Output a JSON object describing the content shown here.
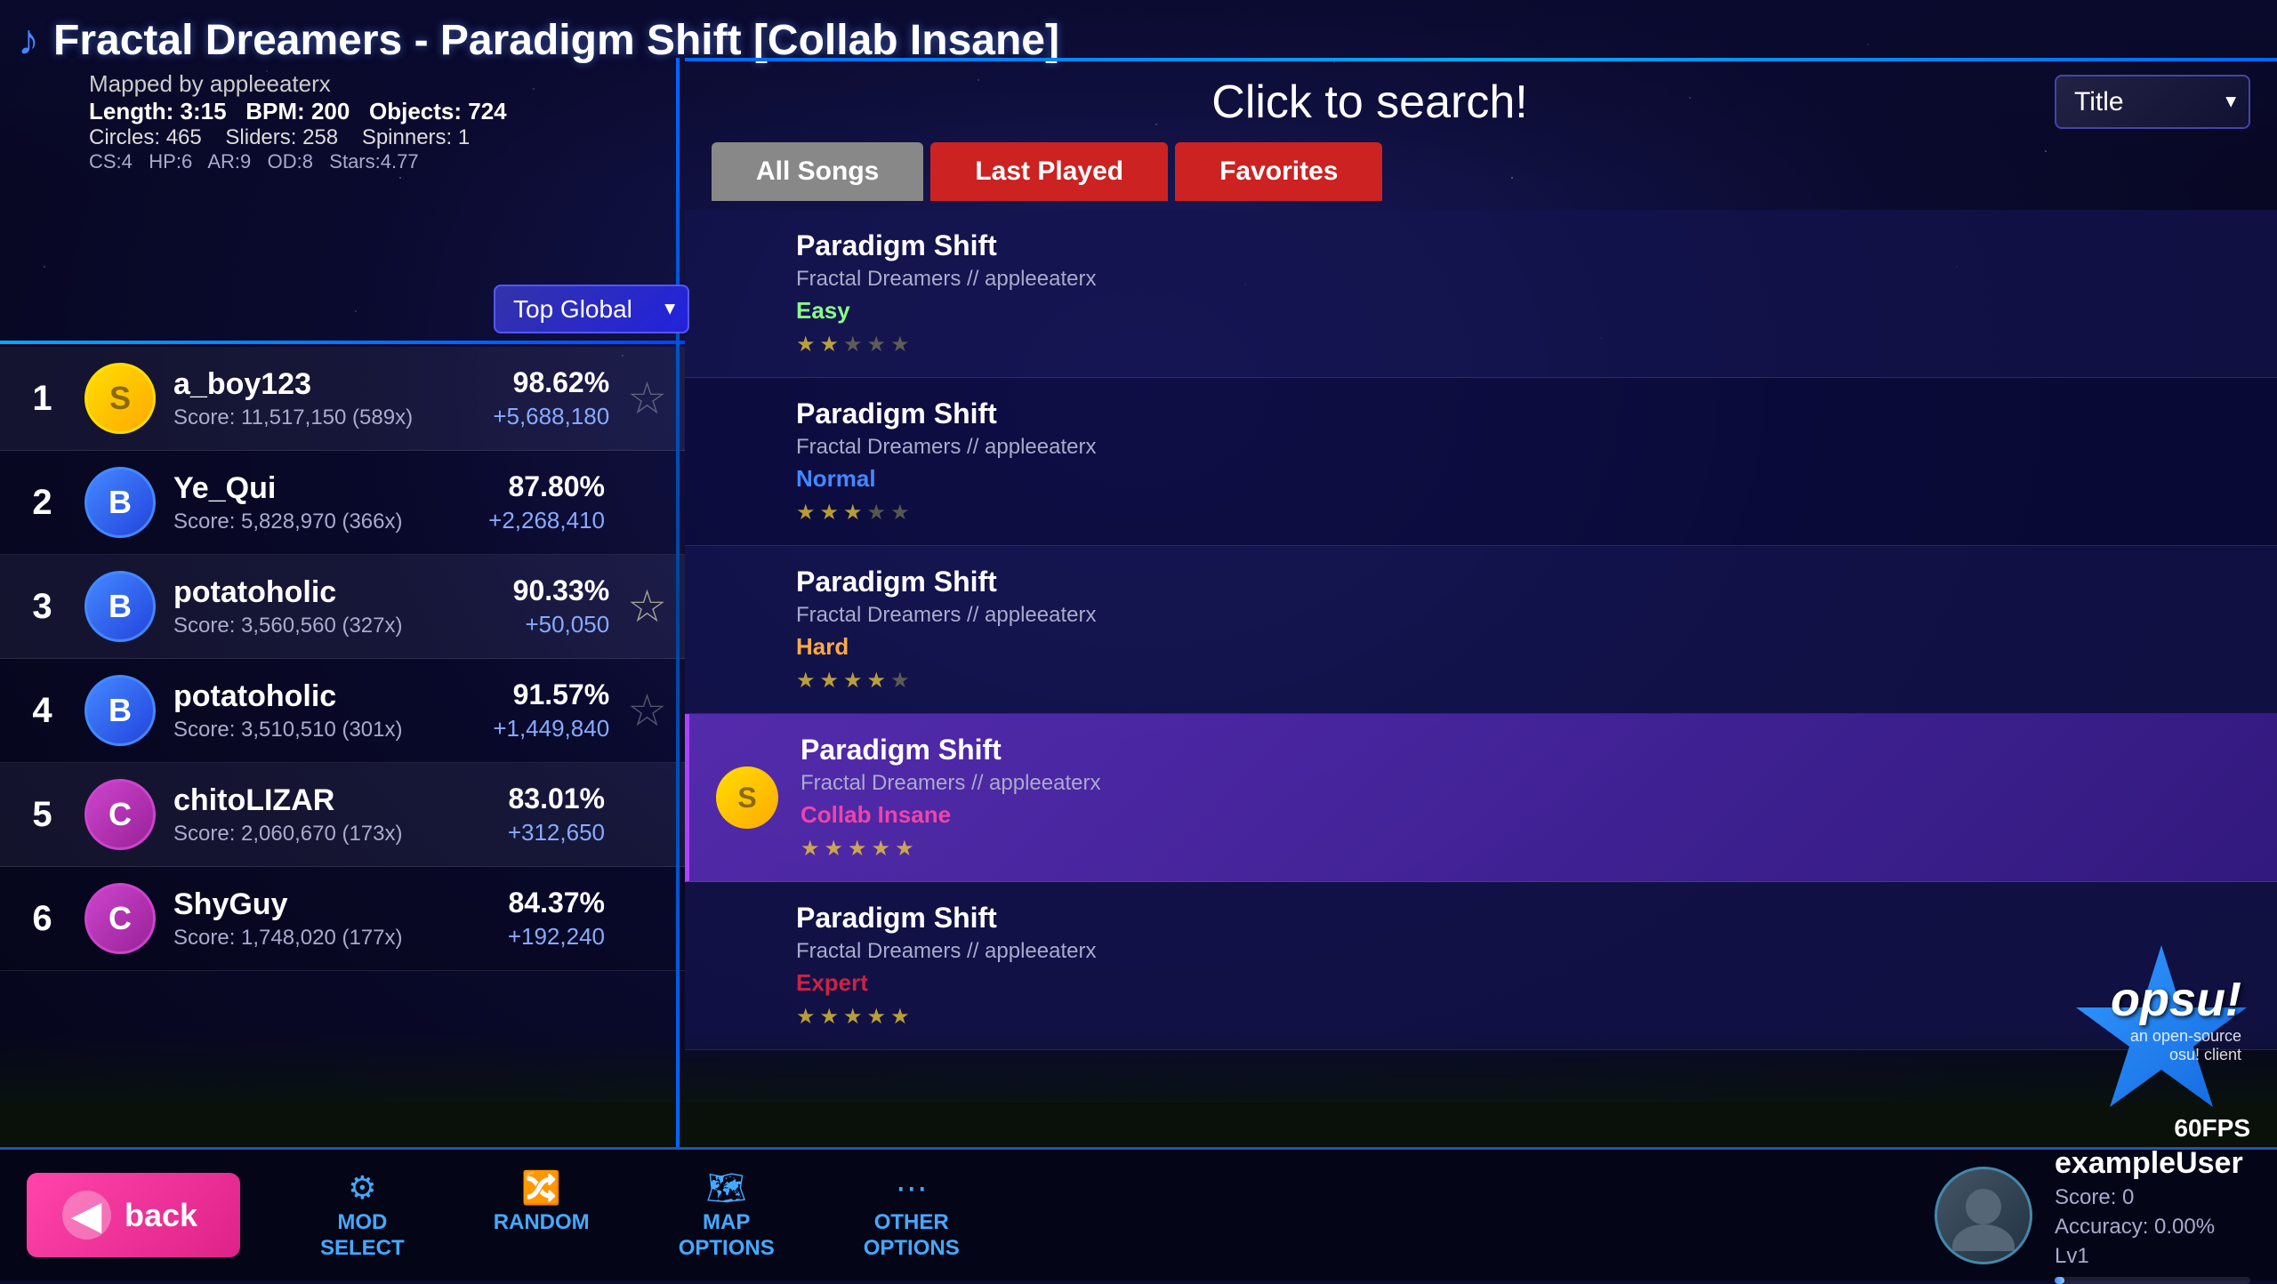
{
  "background": {
    "gradient_start": "#1a1a5e",
    "gradient_end": "#0a0a2e"
  },
  "header": {
    "music_icon": "♪",
    "song_title": "Fractal Dreamers - Paradigm Shift [Collab Insane]",
    "mapped_by": "Mapped by appleeaterx",
    "length_label": "Length:",
    "length_value": "3:15",
    "bpm_label": "BPM:",
    "bpm_value": "200",
    "objects_label": "Objects:",
    "objects_value": "724",
    "circles_label": "Circles:",
    "circles_value": "465",
    "sliders_label": "Sliders:",
    "sliders_value": "258",
    "spinners_label": "Spinners:",
    "spinners_value": "1",
    "cs_label": "CS:4",
    "hp_label": "HP:6",
    "ar_label": "AR:9",
    "od_label": "OD:8",
    "stars_label": "Stars:4.77"
  },
  "leaderboard": {
    "dropdown_label": "Top Global",
    "dropdown_arrow": "▼",
    "entries": [
      {
        "rank": "1",
        "grade": "S",
        "grade_class": "grade-s",
        "username": "a_boy123",
        "score_detail": "Score: 11,517,150 (589x)",
        "accuracy": "98.62%",
        "pp": "+5,688,180",
        "has_star": true,
        "star_active": false
      },
      {
        "rank": "2",
        "grade": "B",
        "grade_class": "grade-b",
        "username": "Ye_Qui",
        "score_detail": "Score: 5,828,970 (366x)",
        "accuracy": "87.80%",
        "pp": "+2,268,410",
        "has_star": false,
        "star_active": false
      },
      {
        "rank": "3",
        "grade": "B",
        "grade_class": "grade-b",
        "username": "potatoholic",
        "score_detail": "Score: 3,560,560 (327x)",
        "accuracy": "90.33%",
        "pp": "+50,050",
        "has_star": true,
        "star_active": true
      },
      {
        "rank": "4",
        "grade": "B",
        "grade_class": "grade-b",
        "username": "potatoholic",
        "score_detail": "Score: 3,510,510 (301x)",
        "accuracy": "91.57%",
        "pp": "+1,449,840",
        "has_star": true,
        "star_active": false
      },
      {
        "rank": "5",
        "grade": "C",
        "grade_class": "grade-c",
        "username": "chitoLIZAR",
        "score_detail": "Score: 2,060,670 (173x)",
        "accuracy": "83.01%",
        "pp": "+312,650",
        "has_star": false,
        "star_active": false
      },
      {
        "rank": "6",
        "grade": "C",
        "grade_class": "grade-c",
        "username": "ShyGuy",
        "score_detail": "Score: 1,748,020 (177x)",
        "accuracy": "84.37%",
        "pp": "+192,240",
        "has_star": false,
        "star_active": false
      }
    ]
  },
  "search": {
    "click_to_search_text": "Click to search!",
    "title_label": "Title",
    "dropdown_arrow": "▼"
  },
  "tabs": {
    "all_songs": "All Songs",
    "last_played": "Last Played",
    "favorites": "Favorites"
  },
  "difficulties": [
    {
      "title": "Paradigm Shift",
      "mapper": "Fractal Dreamers // appleeaterx",
      "diff_name": "Easy",
      "diff_class": "easy",
      "active": false,
      "has_grade": false,
      "grade": "",
      "grade_class": "",
      "stars": [
        true,
        true,
        false,
        false,
        false
      ]
    },
    {
      "title": "Paradigm Shift",
      "mapper": "Fractal Dreamers // appleeaterx",
      "diff_name": "Normal",
      "diff_class": "normal",
      "active": false,
      "has_grade": false,
      "grade": "",
      "grade_class": "",
      "stars": [
        true,
        true,
        true,
        false,
        false
      ]
    },
    {
      "title": "Paradigm Shift",
      "mapper": "Fractal Dreamers // appleeaterx",
      "diff_name": "Hard",
      "diff_class": "hard",
      "active": false,
      "has_grade": false,
      "grade": "",
      "grade_class": "",
      "stars": [
        true,
        true,
        true,
        true,
        false
      ]
    },
    {
      "title": "Paradigm Shift",
      "mapper": "Fractal Dreamers // appleeaterx",
      "diff_name": "Collab Insane",
      "diff_class": "insane",
      "active": true,
      "has_grade": true,
      "grade": "S",
      "grade_class": "grade-s",
      "stars": [
        true,
        true,
        true,
        true,
        true
      ]
    },
    {
      "title": "Paradigm Shift",
      "mapper": "Fractal Dreamers // appleeaterx",
      "diff_name": "Expert",
      "diff_class": "expert",
      "active": false,
      "has_grade": false,
      "grade": "",
      "grade_class": "",
      "stars": [
        true,
        true,
        true,
        true,
        true
      ]
    }
  ],
  "bottom_bar": {
    "back_label": "back",
    "back_arrow": "◀",
    "buttons": [
      {
        "id": "mod-select",
        "icon": "⚙",
        "label": "MOD\nSELECT"
      },
      {
        "id": "random",
        "icon": "🔀",
        "label": "RANDOM"
      },
      {
        "id": "map-options",
        "icon": "🗺",
        "label": "MAP\nOPTIONS"
      },
      {
        "id": "other-options",
        "icon": "⋯",
        "label": "OTHER\nOPTIONS"
      }
    ]
  },
  "user": {
    "username": "exampleUser",
    "score": "Score: 0",
    "accuracy": "Accuracy: 0.00%",
    "level": "Lv1",
    "progress": 5
  },
  "opsu": {
    "name": "opsu!",
    "subtitle1": "an open-source",
    "subtitle2": "osu! client",
    "fps": "60FPS"
  }
}
